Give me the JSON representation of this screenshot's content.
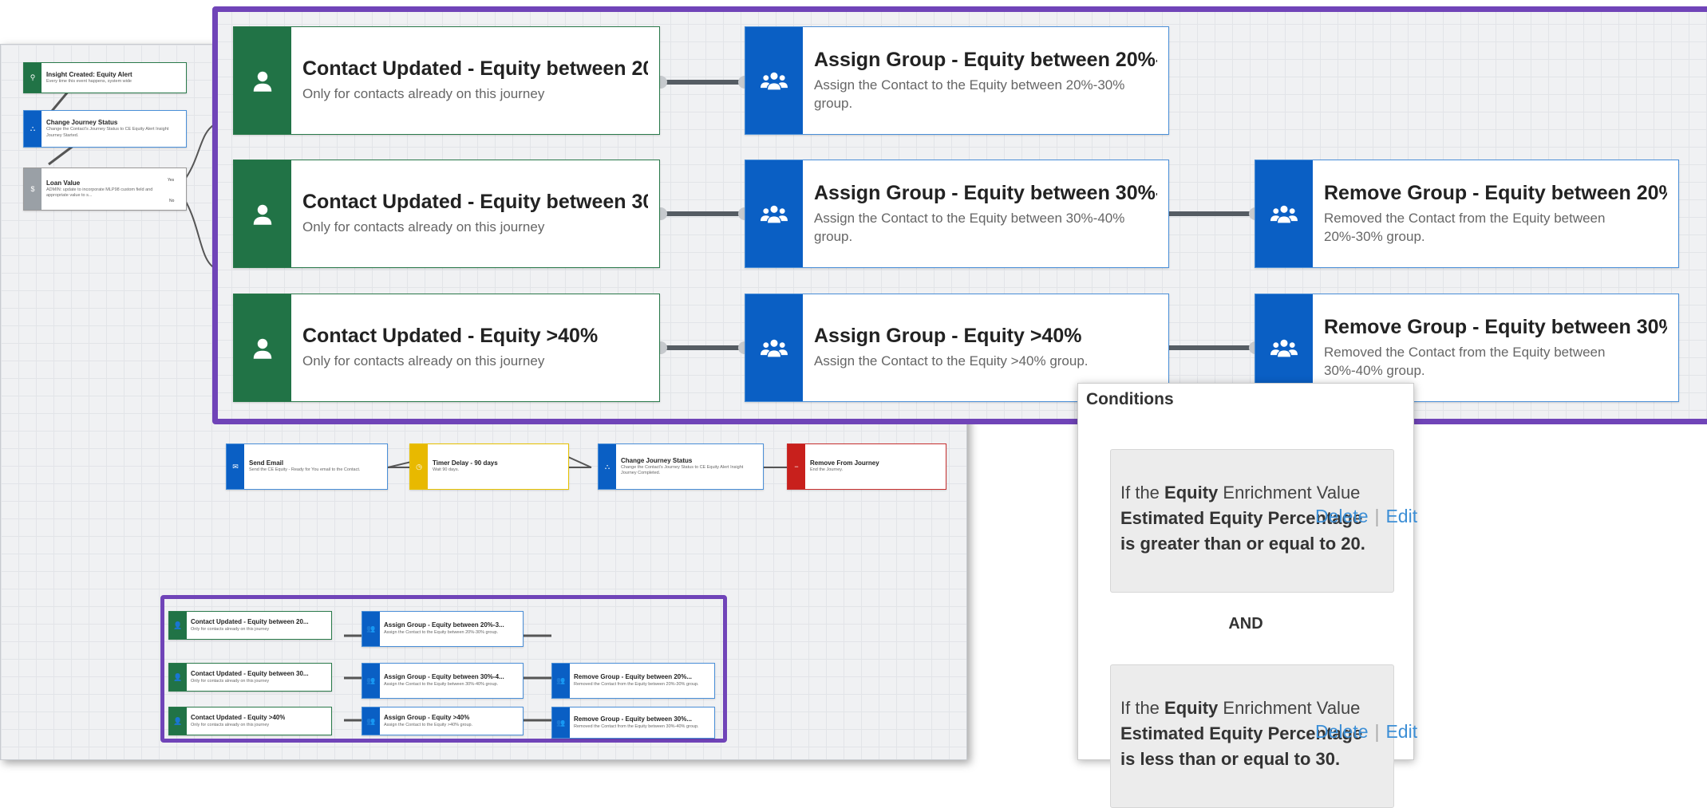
{
  "left_journey": {
    "insight": {
      "title": "Insight Created: Equity Alert",
      "sub": "Every time this event happens, system wide"
    },
    "change1": {
      "title": "Change Journey Status",
      "sub": "Change the Contact's Journey Status to CE Equity Alert Insight Journey Started."
    },
    "loan": {
      "title": "Loan Value",
      "sub": "ADMIN: update to incorporate MLP98 custom field and appropriate value to s...",
      "yes": "Yes",
      "no": "No"
    },
    "send_email": {
      "title": "Send Email",
      "sub": "Send the CE Equity - Ready for You email to the Contact."
    },
    "timer": {
      "title": "Timer Delay - 90 days",
      "sub": "Wait 90 days."
    },
    "change2": {
      "title": "Change Journey Status",
      "sub": "Change the Contact's Journey Status to CE Equity Alert Insight Journey Completed."
    },
    "remove": {
      "title": "Remove From Journey",
      "sub": "End the Journey."
    }
  },
  "branches": {
    "row1": {
      "contact": {
        "title": "Contact Updated - Equity between 20...",
        "sub": "Only for contacts already on this journey"
      },
      "assign": {
        "title": "Assign Group - Equity between 20%-3...",
        "sub": "Assign the Contact to the Equity between 20%-30% group."
      }
    },
    "row2": {
      "contact": {
        "title": "Contact Updated - Equity between 30...",
        "sub": "Only for contacts already on this journey"
      },
      "assign": {
        "title": "Assign Group - Equity between 30%-4...",
        "sub": "Assign the Contact to the Equity between 30%-40% group."
      },
      "remove": {
        "title": "Remove Group - Equity between 20%...",
        "sub": "Removed the Contact from the Equity between 20%-30% group."
      }
    },
    "row3": {
      "contact": {
        "title": "Contact Updated - Equity >40%",
        "sub": "Only for contacts already on this journey"
      },
      "assign": {
        "title": "Assign Group - Equity >40%",
        "sub": "Assign the Contact to the Equity >40% group."
      },
      "remove": {
        "title": "Remove Group - Equity between 30%...",
        "sub": "Removed the Contact from the Equity between 30%-40% group."
      }
    }
  },
  "conditions": {
    "header": "Conditions",
    "c1": {
      "pre": "If the ",
      "field": "Equity",
      "mid": " Enrichment Value",
      "line2": "Estimated Equity Percentage",
      "line3": "is greater than or equal to 20."
    },
    "c2": {
      "pre": "If the ",
      "field": "Equity",
      "mid": " Enrichment Value",
      "line2": "Estimated Equity Percentage",
      "line3": "is less than or equal to 30."
    },
    "and": "AND",
    "delete": "Delete",
    "sep": "|",
    "edit": "Edit"
  },
  "colors": {
    "frame": "#7044b8",
    "green": "#217346",
    "blue": "#0a5fc4",
    "yellow": "#e8b900",
    "red": "#c8201c",
    "link": "#3d8fd6"
  }
}
